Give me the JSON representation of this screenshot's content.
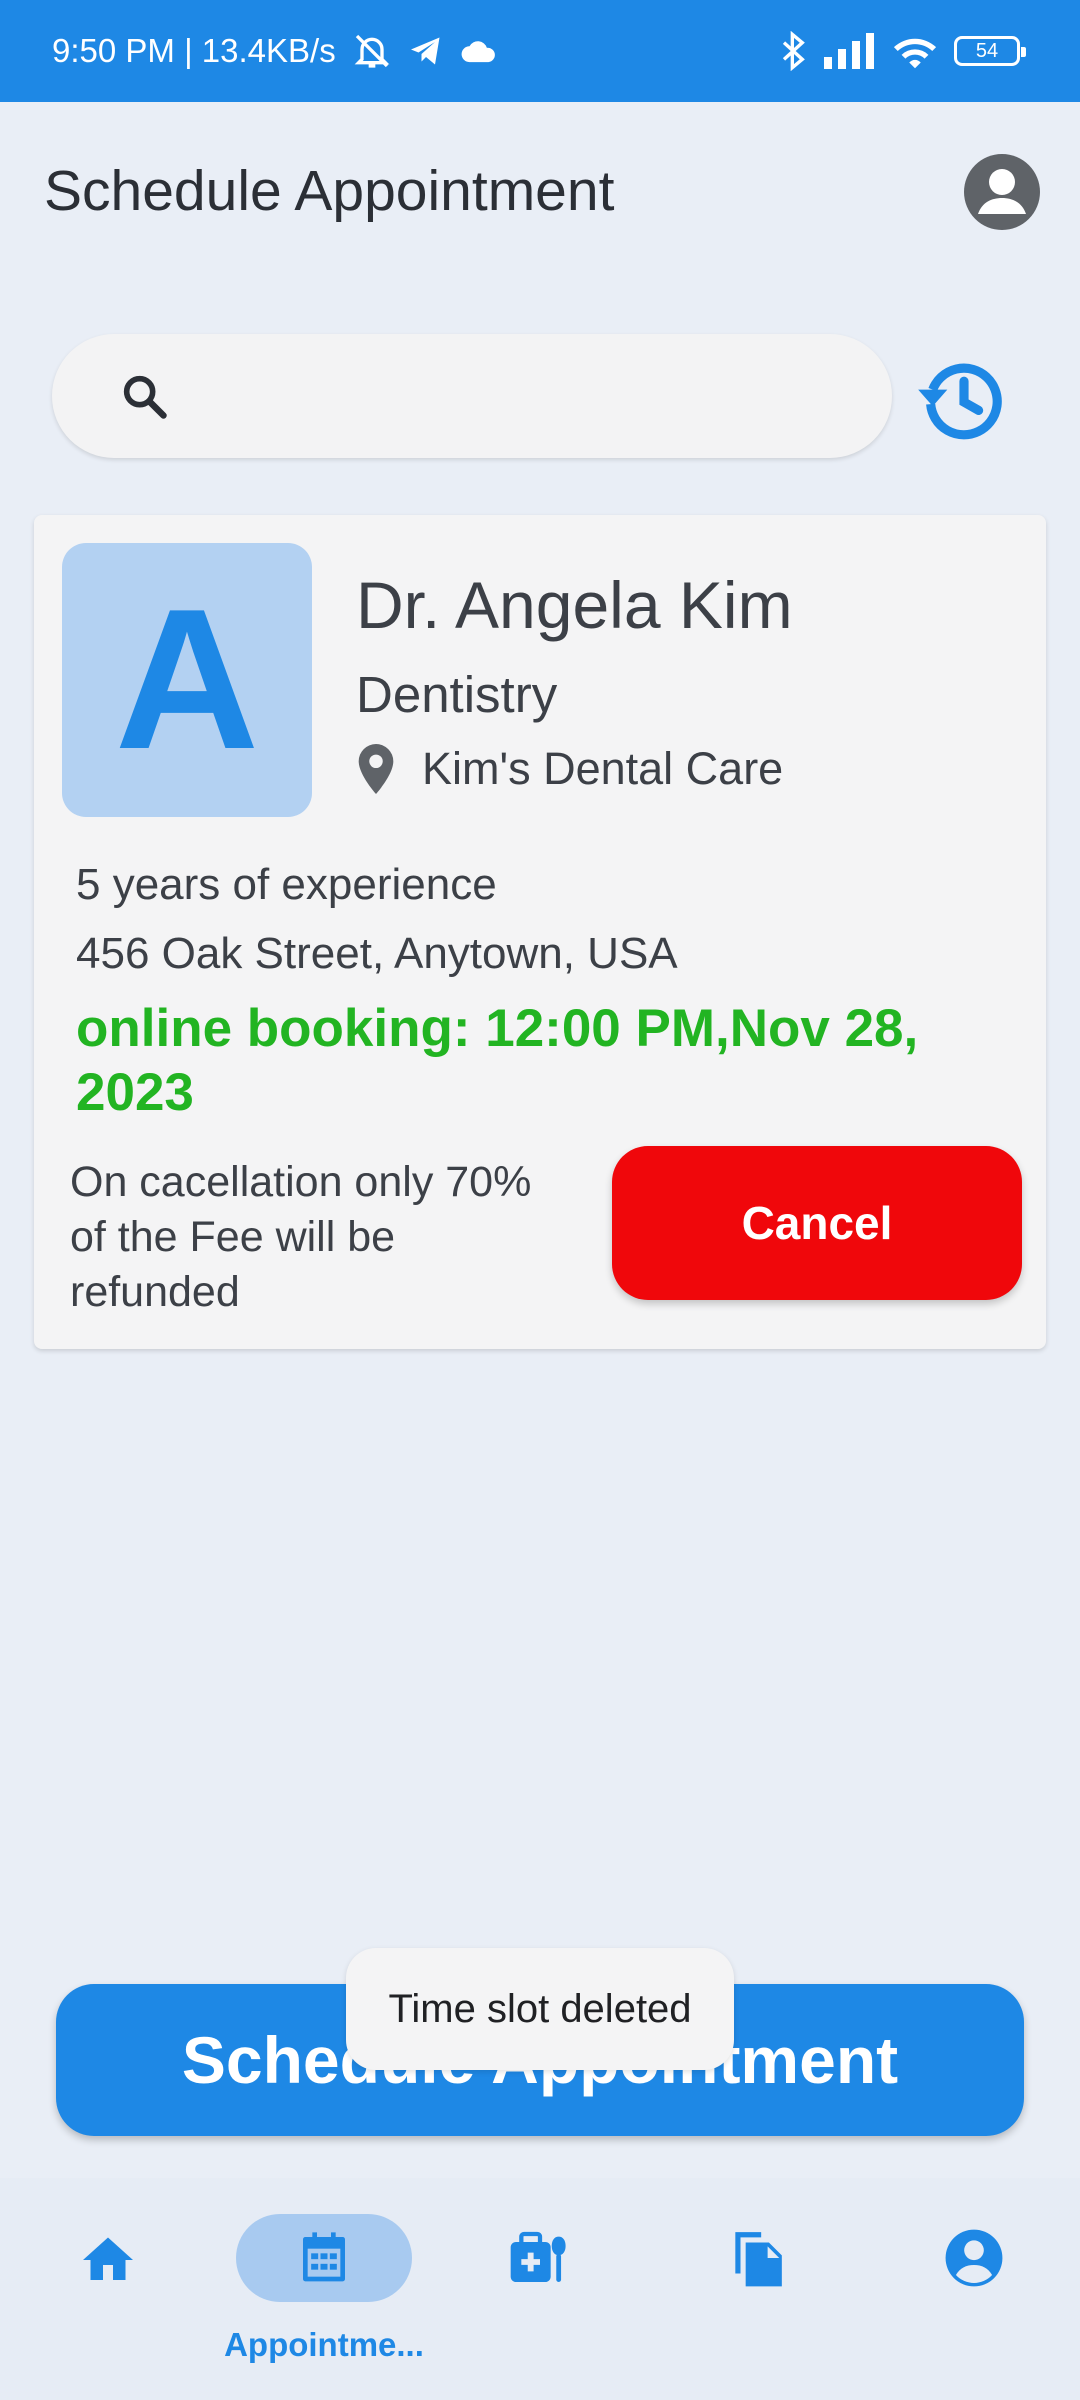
{
  "status_bar": {
    "time_speed": "9:50 PM | 13.4KB/s",
    "battery": "54"
  },
  "header": {
    "title": "Schedule Appointment"
  },
  "search": {
    "placeholder": "",
    "value": ""
  },
  "doctor": {
    "avatar_letter": "A",
    "name": "Dr. Angela Kim",
    "specialty": "Dentistry",
    "clinic": "Kim's Dental Care",
    "experience": "5 years of experience",
    "address": "456 Oak Street, Anytown, USA",
    "booking": "online booking: 12:00 PM,Nov 28, 2023",
    "refund_note": "On cacellation only 70% of the Fee will be refunded",
    "cancel_label": "Cancel"
  },
  "actions": {
    "schedule_label": "Schedule Appointment"
  },
  "toast": {
    "message": "Time slot deleted"
  },
  "bottom_nav": {
    "items": [
      {
        "icon": "home-icon"
      },
      {
        "icon": "calendar-icon",
        "label": "Appointme..."
      },
      {
        "icon": "medical-bag-icon"
      },
      {
        "icon": "documents-icon"
      },
      {
        "icon": "account-icon"
      }
    ]
  },
  "colors": {
    "primary": "#1e88e5",
    "danger": "#f0070b",
    "success": "#22b422",
    "background": "#e9eef6"
  }
}
